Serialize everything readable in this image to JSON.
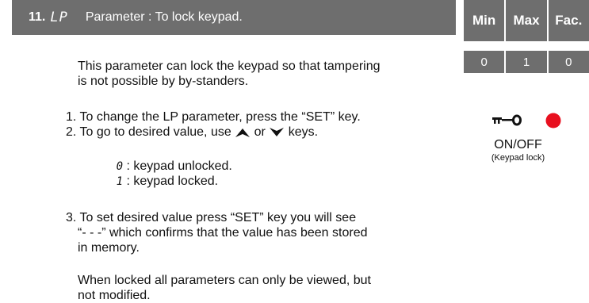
{
  "header": {
    "number": "11.",
    "code": "LP",
    "title": "Parameter :  To lock keypad."
  },
  "value_table": {
    "columns": [
      "Min",
      "Max",
      "Fac."
    ],
    "values": [
      "0",
      "1",
      "0"
    ]
  },
  "body": {
    "intro_line1": "This parameter can lock the keypad so that tampering",
    "intro_line2": "is not possible by by-standers.",
    "step1": "1. To change the LP parameter, press the “SET” key.",
    "step2_before": "2. To go to desired value, use ",
    "step2_middle": "or ",
    "step2_after": " keys.",
    "option_0_digit": "0",
    "option_0_text": " :  keypad unlocked.",
    "option_1_digit": "1",
    "option_1_text": " :  keypad locked.",
    "step3_line1": "3. To set desired value press “SET” key you will see",
    "step3_line2": "“- - -” which confirms that the value has been stored",
    "step3_line3": "in memory.",
    "note_line1": "When locked all parameters can only be viewed, but",
    "note_line2": "not modified."
  },
  "indicator": {
    "label": "ON/OFF",
    "sublabel": "(Keypad lock)",
    "led_color": "#e8101f",
    "icon": "key-icon"
  }
}
